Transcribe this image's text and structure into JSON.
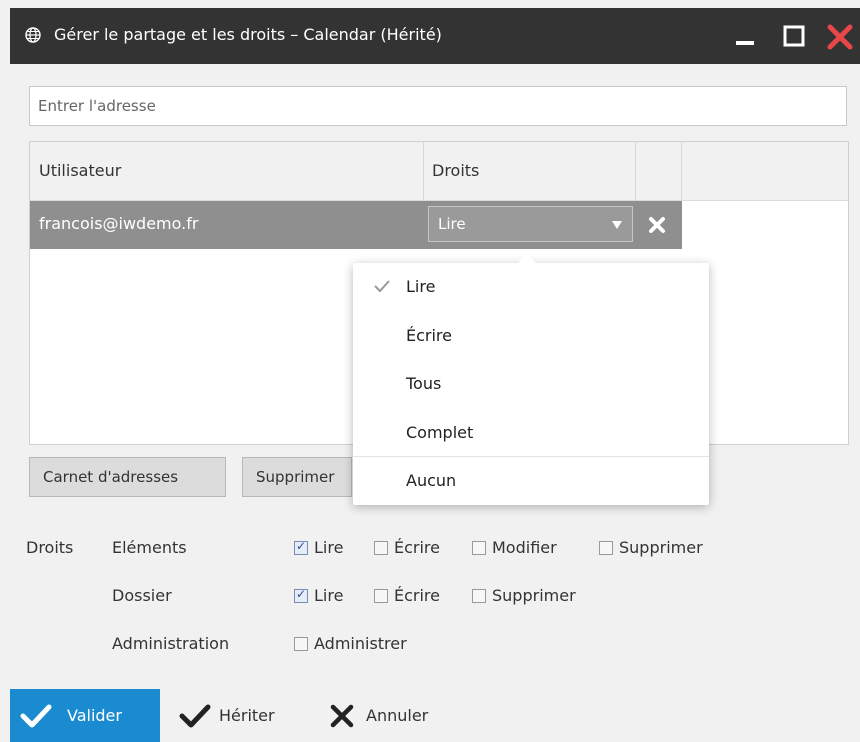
{
  "window": {
    "title": "Gérer le partage et les droits – Calendar (Hérité)",
    "controls": {
      "minimize": "minimize-icon",
      "maximize": "maximize-icon",
      "close": "close-icon"
    },
    "close_color": "#e8474a"
  },
  "address": {
    "placeholder": "Entrer l'adresse",
    "value": ""
  },
  "table": {
    "headers": {
      "user": "Utilisateur",
      "rights": "Droits"
    },
    "rows": [
      {
        "user": "francois@iwdemo.fr",
        "rights": "Lire"
      }
    ]
  },
  "dropdown": {
    "options": [
      {
        "label": "Lire",
        "selected": true
      },
      {
        "label": "Écrire",
        "selected": false
      },
      {
        "label": "Tous",
        "selected": false
      },
      {
        "label": "Complet",
        "selected": false
      },
      {
        "label": "Aucun",
        "selected": false
      }
    ]
  },
  "buttons": {
    "address_book": "Carnet d'adresses",
    "delete": "Supprimer"
  },
  "rights": {
    "label": "Droits",
    "elements": {
      "label": "Eléments",
      "options": [
        {
          "label": "Lire",
          "checked": true
        },
        {
          "label": "Écrire",
          "checked": false
        },
        {
          "label": "Modifier",
          "checked": false
        },
        {
          "label": "Supprimer",
          "checked": false
        }
      ]
    },
    "folder": {
      "label": "Dossier",
      "options": [
        {
          "label": "Lire",
          "checked": true
        },
        {
          "label": "Écrire",
          "checked": false
        },
        {
          "label": "Supprimer",
          "checked": false
        }
      ]
    },
    "administration": {
      "label": "Administration",
      "options": [
        {
          "label": "Administrer",
          "checked": false
        }
      ]
    }
  },
  "footer": {
    "validate": "Valider",
    "inherit": "Hériter",
    "cancel": "Annuler"
  },
  "colors": {
    "title_bar": "#333333",
    "accent": "#1a8bd0",
    "row_selected": "#8f8f8f"
  }
}
